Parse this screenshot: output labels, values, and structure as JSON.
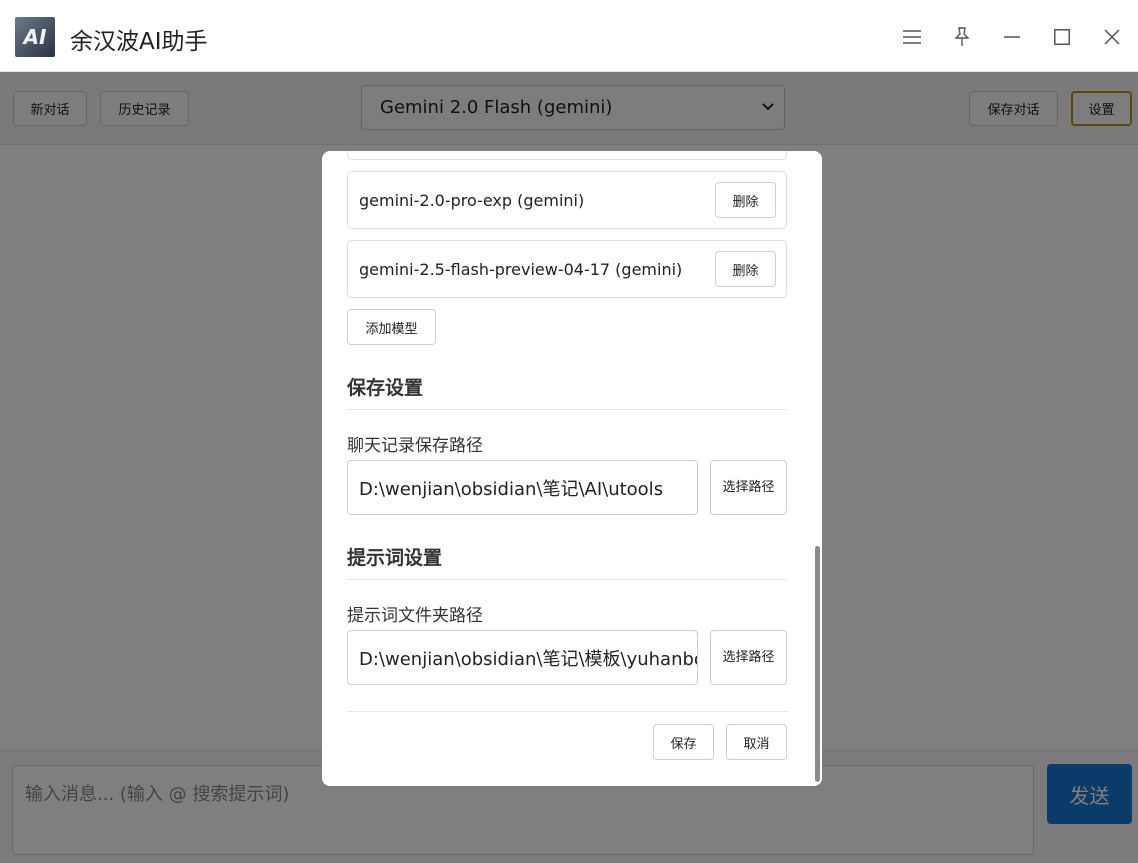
{
  "app": {
    "title": "余汉波AI助手",
    "logo_text": "AI"
  },
  "window_controls": {
    "menu": "≡",
    "pin": "📌",
    "minimize": "—",
    "maximize": "☐",
    "close": "✕"
  },
  "toolbar": {
    "new_chat": "新对话",
    "history": "历史记录",
    "model_selected": "Gemini 2.0 Flash (gemini)",
    "save_chat": "保存对话",
    "settings": "设置"
  },
  "input": {
    "placeholder": "输入消息... (输入 @ 搜索提示词)",
    "send": "发送"
  },
  "settings_modal": {
    "models": [
      {
        "name": "gemini-2.0-pro-exp (gemini)",
        "delete_label": "删除"
      },
      {
        "name": "gemini-2.5-flash-preview-04-17 (gemini)",
        "delete_label": "删除"
      }
    ],
    "add_model": "添加模型",
    "save_section": {
      "title": "保存设置",
      "label": "聊天记录保存路径",
      "path": "D:\\wenjian\\obsidian\\笔记\\AI\\utools",
      "choose": "选择路径"
    },
    "prompt_section": {
      "title": "提示词设置",
      "label": "提示词文件夹路径",
      "path": "D:\\wenjian\\obsidian\\笔记\\模板\\yuhanbo",
      "choose": "选择路径"
    },
    "save": "保存",
    "cancel": "取消"
  },
  "colors": {
    "accent": "#1677d2",
    "settings_border": "#c08a1e",
    "overlay": "rgba(0,0,0,0.5)"
  }
}
